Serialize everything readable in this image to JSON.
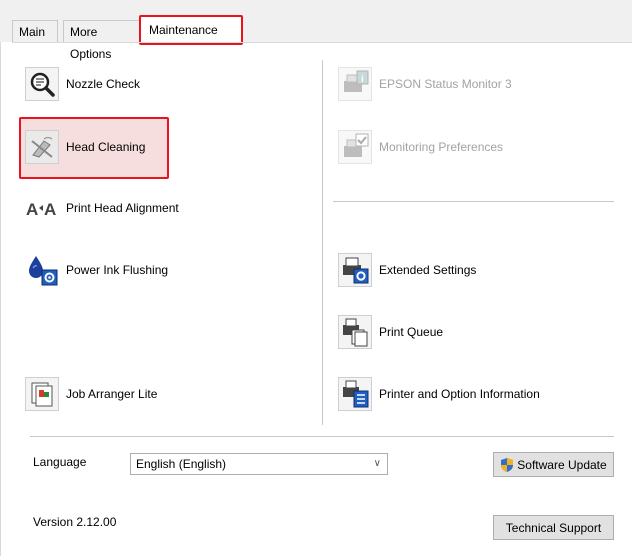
{
  "tabs": [
    {
      "label": "Main"
    },
    {
      "label": "More Options"
    },
    {
      "label": "Maintenance"
    }
  ],
  "left": {
    "nozzle_check": "Nozzle Check",
    "head_cleaning": "Head Cleaning",
    "print_head_alignment": "Print Head Alignment",
    "power_ink_flushing": "Power Ink Flushing",
    "job_arranger_lite": "Job Arranger Lite"
  },
  "right": {
    "status_monitor": "EPSON Status Monitor 3",
    "monitoring_prefs": "Monitoring Preferences",
    "extended_settings": "Extended Settings",
    "print_queue": "Print Queue",
    "printer_info": "Printer and Option Information"
  },
  "footer": {
    "language_label": "Language",
    "language_value": "English (English)",
    "software_update": "Software Update",
    "version": "Version 2.12.00",
    "technical_support": "Technical Support"
  },
  "icons": {
    "nozzle_check": "magnifier-nozzle-icon",
    "head_cleaning": "head-cleaning-icon",
    "alignment": "alignment-icon",
    "ink_flushing": "ink-drop-gear-icon",
    "job_arranger": "job-arranger-icon",
    "status_monitor": "printer-info-icon",
    "monitoring_prefs": "printer-check-icon",
    "extended_settings": "printer-gear-icon",
    "print_queue": "printer-pages-icon",
    "printer_info": "printer-list-icon",
    "shield": "shield-icon"
  },
  "colors": {
    "highlight_border": "#e8131d",
    "highlight_fill": "#f7dede",
    "disabled_text": "#a3a3a3"
  }
}
